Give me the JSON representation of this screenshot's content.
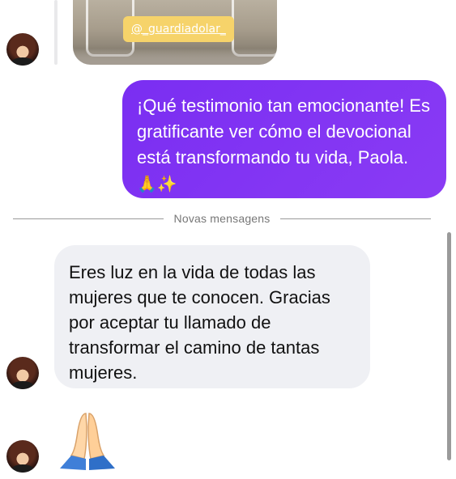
{
  "story": {
    "tag": "@_guardiadolar_"
  },
  "messages": {
    "outgoing": {
      "text": "¡Qué testimonio tan emocionante! Es gratificante ver cómo el devocional está transformando tu vida, Paola.",
      "emoji": "🙏✨"
    },
    "incoming": {
      "text": "Eres luz en la vida de todas las mujeres que te conocen. Gracias por aceptar tu llamado de transformar el camino de tantas mujeres."
    },
    "reaction_emoji": "🙏"
  },
  "separator": {
    "label": "Novas mensagens"
  },
  "colors": {
    "outgoing_bubble": "#7b2ff7",
    "incoming_bubble": "#eff0f4",
    "tag": "#f6d36a"
  }
}
